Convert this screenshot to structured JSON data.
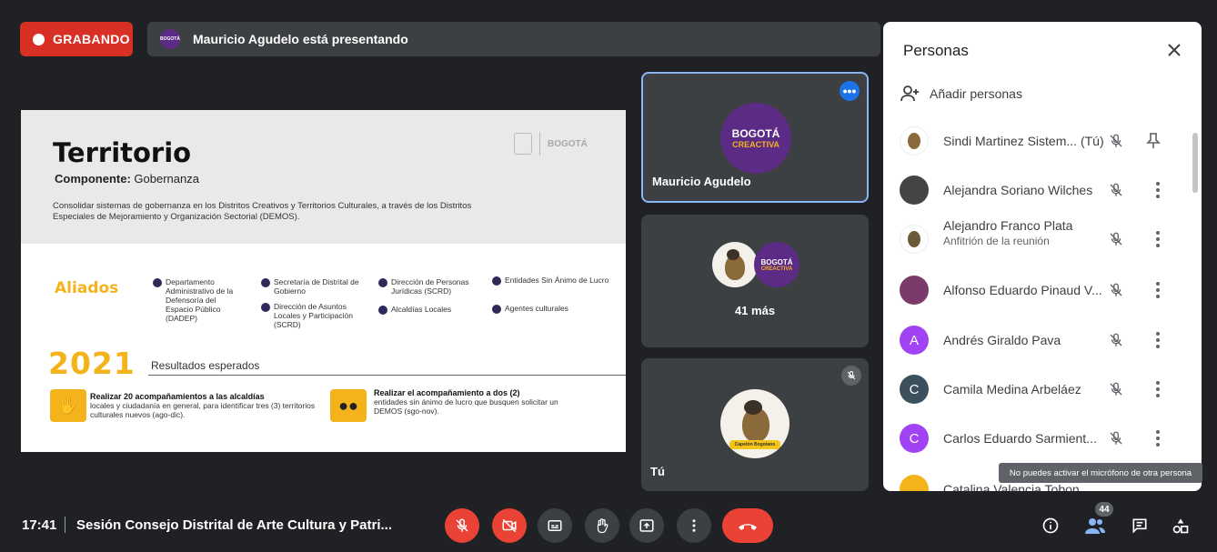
{
  "top": {
    "recording_label": "GRABANDO",
    "presenting_text": "Mauricio Agudelo está presentando"
  },
  "slide": {
    "title": "Territorio",
    "component_label": "Componente:",
    "component_value": "Gobernanza",
    "description": "Consolidar sistemas de gobernanza en los Distritos Creativos y Territorios Culturales, a través de los Distritos Especiales de Mejoramiento y Organización Sectorial (DEMOS).",
    "logo_text": "BOGOTÁ",
    "aliados_label": "Aliados",
    "allies": [
      "Departamento Administrativo de la Defensoría del Espacio Público (DADEP)",
      "Secretaría de Distrital de Gobierno",
      "Dirección de Asuntos Locales y Participación (SCRD)",
      "Dirección de Personas Jurídicas (SCRD)",
      "Alcaldías Locales",
      "Entidades Sin Ánimo de Lucro",
      "Agentes culturales"
    ],
    "year": "2021",
    "results_label": "Resultados esperados",
    "result1_title": "Realizar 20 acompañamientos a las alcaldías",
    "result1_text": "locales y ciudadanía en general, para identificar tres (3) territorios culturales nuevos (ago-dic).",
    "result2_title": "Realizar el acompañamiento a dos (2)",
    "result2_text": "entidades sin ánimo de lucro que busquen solicitar un DEMOS (sgo-nov)."
  },
  "tiles": {
    "presenter_name": "Mauricio Agudelo",
    "logo_line1": "BOGOTÁ",
    "logo_line2": "CREACTIVA",
    "more_label": "41 más",
    "you_label": "Tú",
    "bird_banner": "Capetón Bogotano"
  },
  "panel": {
    "title": "Personas",
    "add_label": "Añadir personas",
    "people": [
      {
        "name": "Sindi Martinez Sistem... (Tú)",
        "sub": "",
        "avatar_color": "#ffffff",
        "initial": ""
      },
      {
        "name": "Alejandra Soriano Wilches",
        "sub": "",
        "avatar_color": "#444444",
        "initial": ""
      },
      {
        "name": "Alejandro Franco Plata",
        "sub": "Anfitrión de la reunión",
        "avatar_color": "#ffffff",
        "initial": ""
      },
      {
        "name": "Alfonso Eduardo Pinaud V...",
        "sub": "",
        "avatar_color": "#7a3b6a",
        "initial": ""
      },
      {
        "name": "Andrés Giraldo Pava",
        "sub": "",
        "avatar_color": "#a142f4",
        "initial": "A"
      },
      {
        "name": "Camila Medina Arbeláez",
        "sub": "",
        "avatar_color": "#3c4f5c",
        "initial": "C"
      },
      {
        "name": "Carlos Eduardo Sarmient...",
        "sub": "",
        "avatar_color": "#a142f4",
        "initial": "C"
      },
      {
        "name": "Catalina Valencia Tobon",
        "sub": "",
        "avatar_color": "#f5b31b",
        "initial": ""
      }
    ],
    "tooltip": "No puedes activar el micrófono de otra persona"
  },
  "bottom": {
    "time": "17:41",
    "meeting_title": "Sesión Consejo Distrital de Arte Cultura y Patri...",
    "people_count": "44"
  }
}
